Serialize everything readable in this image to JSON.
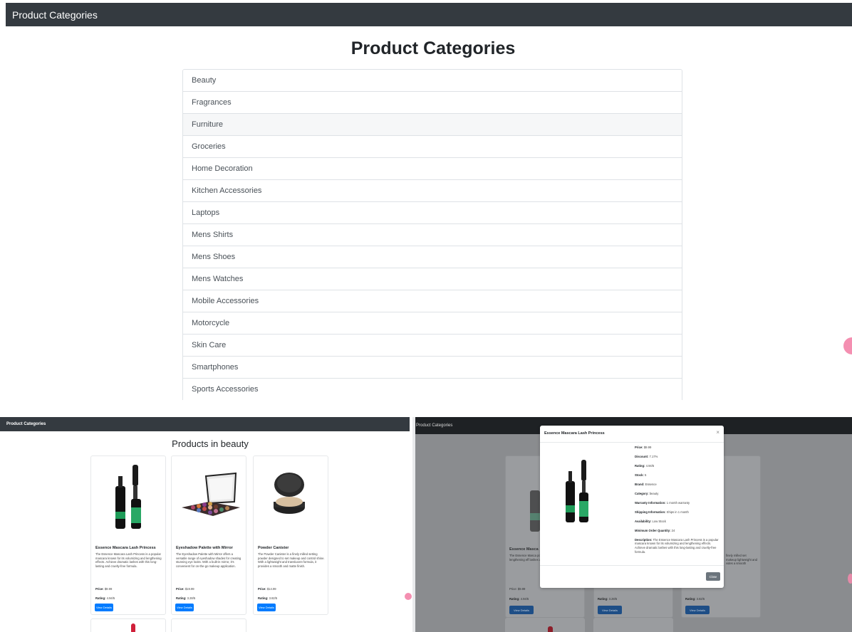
{
  "top": {
    "nav_title": "Product Categories",
    "heading": "Product Categories",
    "categories": [
      "Beauty",
      "Fragrances",
      "Furniture",
      "Groceries",
      "Home Decoration",
      "Kitchen Accessories",
      "Laptops",
      "Mens Shirts",
      "Mens Shoes",
      "Mens Watches",
      "Mobile Accessories",
      "Motorcycle",
      "Skin Care",
      "Smartphones",
      "Sports Accessories"
    ],
    "hovered_category": "Furniture"
  },
  "products_view": {
    "nav_title": "Product Categories",
    "heading": "Products in beauty",
    "products": [
      {
        "title": "Essence Mascara Lash Princess",
        "description": "The Essence Mascara Lash Princess is a popular mascara known for its volumizing and lengthening effects. Achieve dramatic lashes with this long-lasting and cruelty-free formula.",
        "price_label": "Price:",
        "price": "$9.99",
        "rating_label": "Rating:",
        "rating": "4.94/5",
        "button": "View Details",
        "image": "mascara-image"
      },
      {
        "title": "Eyeshadow Palette with Mirror",
        "description": "The Eyeshadow Palette with Mirror offers a versatile range of eyeshadow shades for creating stunning eye looks. With a built-in mirror, it's convenient for on-the-go makeup application.",
        "price_label": "Price:",
        "price": "$19.99",
        "rating_label": "Rating:",
        "rating": "3.28/5",
        "button": "View Details",
        "image": "eyeshadow-palette-image"
      },
      {
        "title": "Powder Canister",
        "description": "The Powder Canister is a finely milled setting powder designed to set makeup and control shine. With a lightweight and translucent formula, it provides a smooth and matte finish.",
        "price_label": "Price:",
        "price": "$14.99",
        "rating_label": "Rating:",
        "rating": "3.82/5",
        "button": "View Details",
        "image": "powder-canister-image"
      }
    ]
  },
  "modal_view": {
    "nav_title": "Product Categories",
    "background_cards": [
      {
        "title": "Essence Masca",
        "description": "The Essence Masca popular mascara kn and lengthening eff lashes with this lon free formula.",
        "price": "Price: $9.99",
        "rating_label": "Rating:",
        "rating": "4.94/5",
        "button": "View Details"
      },
      {
        "title": "",
        "description": "",
        "price": "",
        "rating_label": "Rating:",
        "rating": "3.28/5",
        "button": "View Details"
      },
      {
        "title": "",
        "description": "finely milled set makeup lightweight and vides a smooth",
        "price": "",
        "rating_label": "Rating:",
        "rating": "3.82/5",
        "button": "View Details"
      }
    ],
    "modal": {
      "title": "Essence Mascara Lash Princess",
      "close_symbol": "×",
      "details": [
        {
          "label": "Price:",
          "value": "$9.99"
        },
        {
          "label": "Discount:",
          "value": "7.17%"
        },
        {
          "label": "Rating:",
          "value": "4.94/5"
        },
        {
          "label": "Stock:",
          "value": "5"
        },
        {
          "label": "Brand:",
          "value": "Essence"
        },
        {
          "label": "Category:",
          "value": "beauty"
        },
        {
          "label": "Warranty Information:",
          "value": "1 month warranty"
        },
        {
          "label": "Shipping Information:",
          "value": "Ships in 1 month"
        },
        {
          "label": "Availability:",
          "value": "Low Stock"
        },
        {
          "label": "Minimum Order Quantity:",
          "value": "24"
        },
        {
          "label": "Description:",
          "value": "The Essence Mascara Lash Princess is a popular mascara known for its volumizing and lengthening effects. Achieve dramatic lashes with this long-lasting and cruelty-free formula."
        }
      ],
      "close_button": "Close"
    }
  },
  "colors": {
    "navbar": "#343a40",
    "primary": "#007bff",
    "secondary": "#6c757d",
    "accent_pink": "#f48fb1"
  }
}
